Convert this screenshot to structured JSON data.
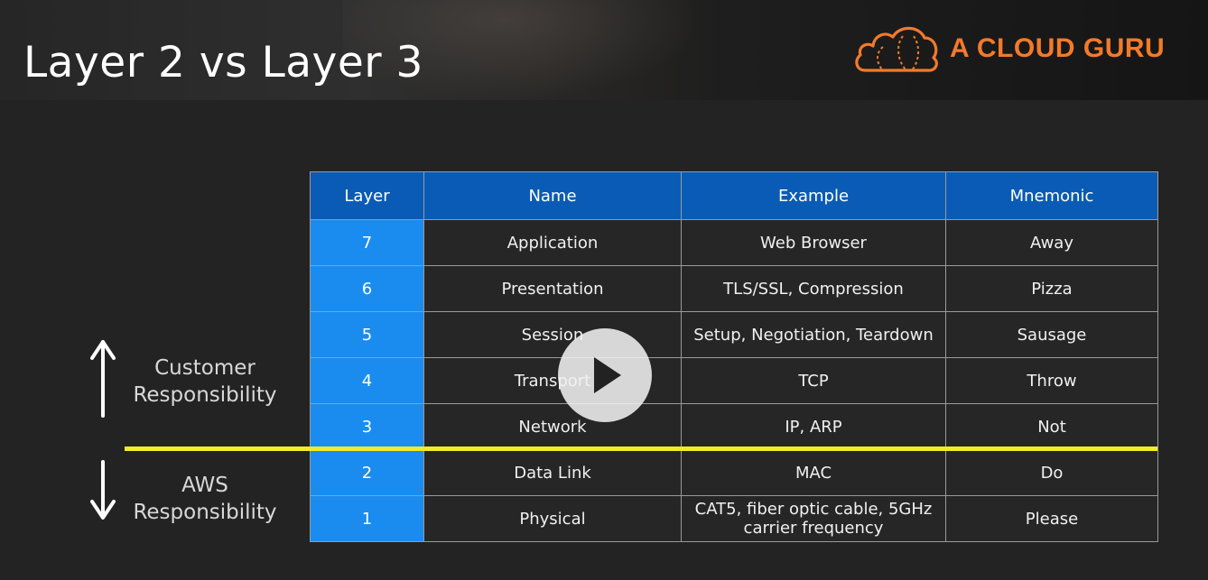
{
  "slide": {
    "title": "Layer 2 vs Layer 3",
    "logo_text": "A CLOUD GURU"
  },
  "table": {
    "headers": [
      "Layer",
      "Name",
      "Example",
      "Mnemonic"
    ],
    "rows": [
      {
        "layer": "7",
        "name": "Application",
        "example": "Web Browser",
        "mnemonic": "Away"
      },
      {
        "layer": "6",
        "name": "Presentation",
        "example": "TLS/SSL, Compression",
        "mnemonic": "Pizza"
      },
      {
        "layer": "5",
        "name": "Session",
        "example": "Setup, Negotiation, Teardown",
        "mnemonic": "Sausage"
      },
      {
        "layer": "4",
        "name": "Transport",
        "example": "TCP",
        "mnemonic": "Throw"
      },
      {
        "layer": "3",
        "name": "Network",
        "example": "IP, ARP",
        "mnemonic": "Not"
      },
      {
        "layer": "2",
        "name": "Data Link",
        "example": "MAC",
        "mnemonic": "Do"
      },
      {
        "layer": "1",
        "name": "Physical",
        "example_line1": "CAT5, fiber optic cable, 5GHz",
        "example_line2": "carrier frequency",
        "mnemonic": "Please"
      }
    ]
  },
  "labels": {
    "customer_line1": "Customer",
    "customer_line2": "Responsibility",
    "aws_line1": "AWS",
    "aws_line2": "Responsibility"
  },
  "colors": {
    "header_blue": "#0a5bb5",
    "layer_blue": "#1a8cef",
    "divider_yellow": "#f2ea2b",
    "logo_orange": "#f37a2a"
  },
  "icons": [
    "cloud-logo-icon",
    "up-arrow-icon",
    "down-arrow-icon",
    "play-icon"
  ]
}
